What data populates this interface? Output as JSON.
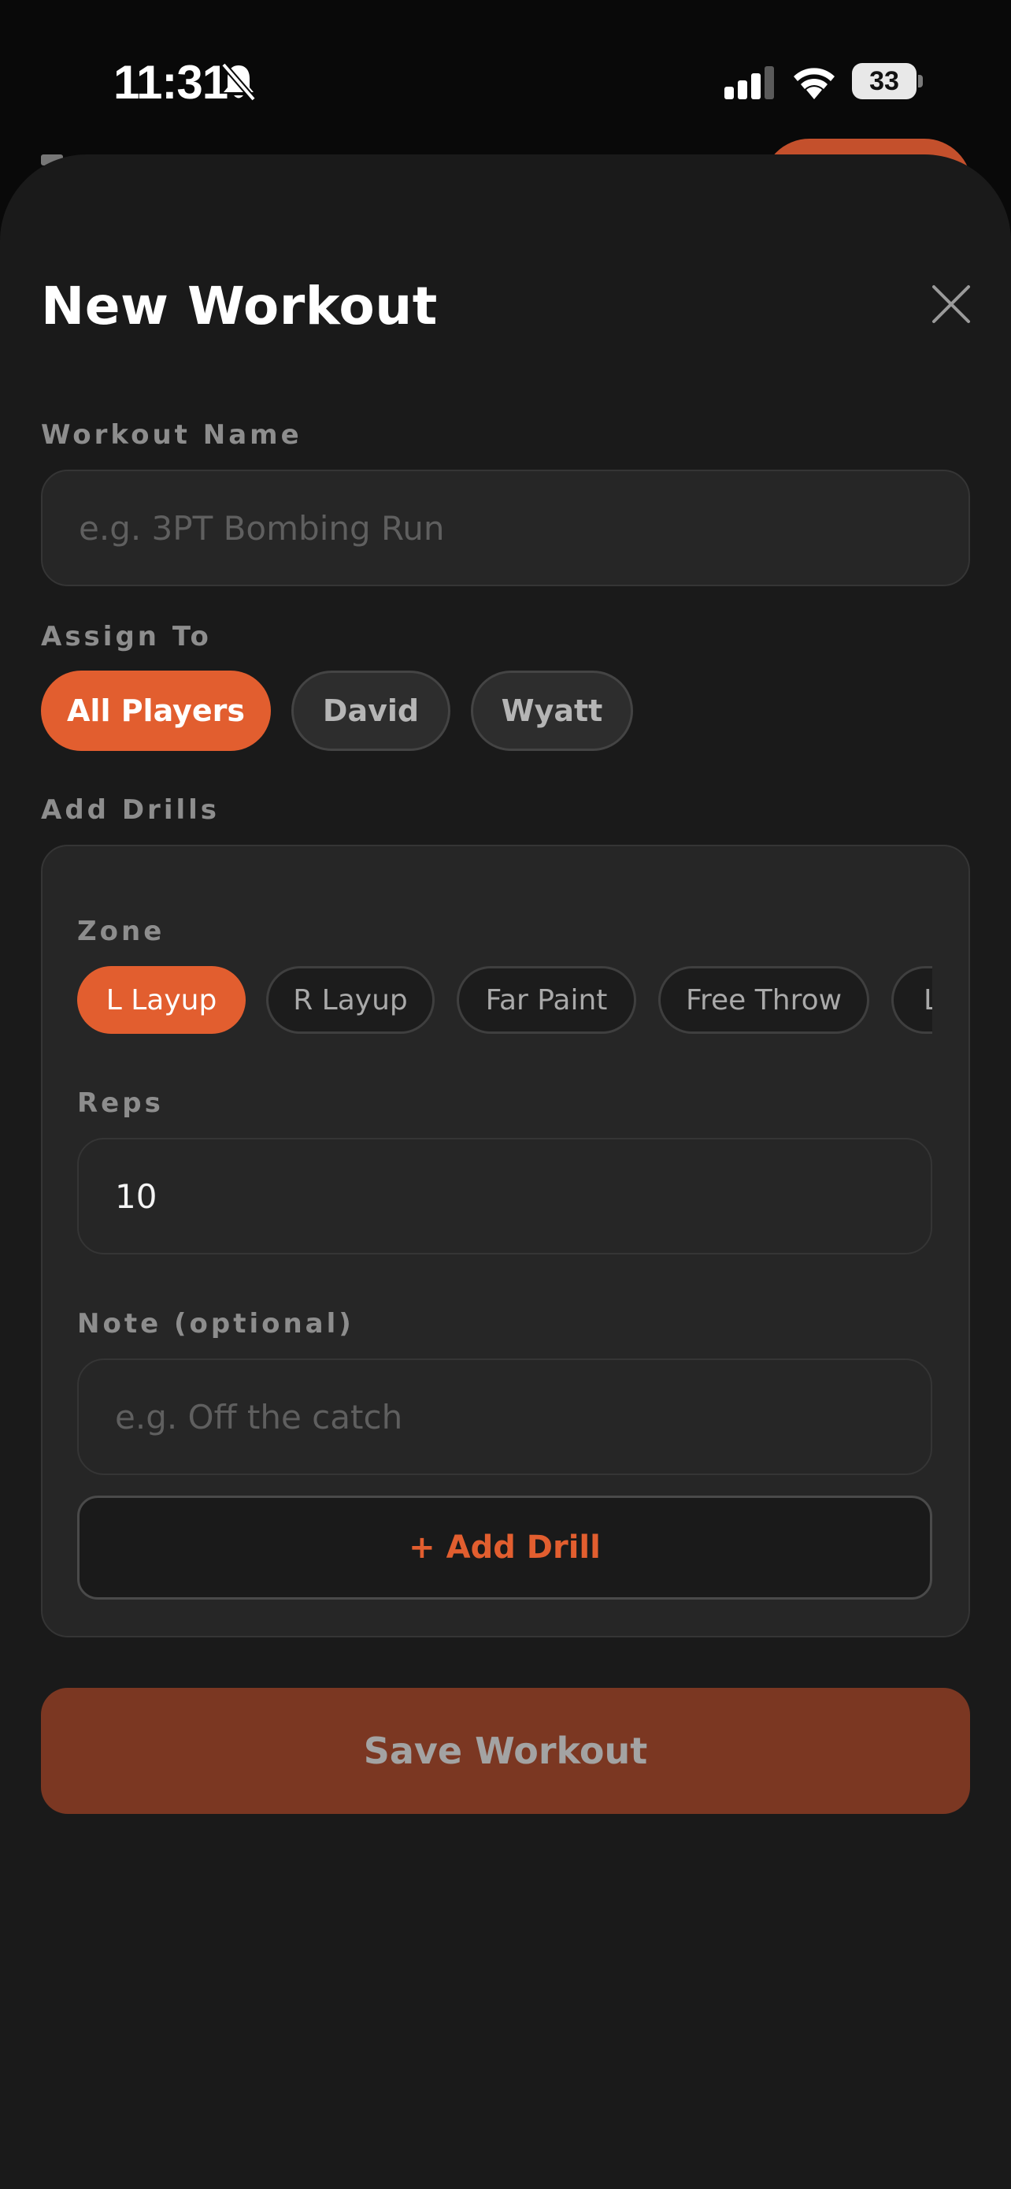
{
  "status_bar": {
    "time": "11:31",
    "battery": "33"
  },
  "sheet": {
    "title": "New Workout"
  },
  "workout_name": {
    "label": "Workout Name",
    "placeholder": "e.g. 3PT Bombing Run",
    "value": ""
  },
  "assign": {
    "label": "Assign To",
    "options": [
      "All Players",
      "David",
      "Wyatt"
    ],
    "selected": "All Players"
  },
  "drills": {
    "label": "Add Drills",
    "zone": {
      "label": "Zone",
      "options": [
        "L Layup",
        "R Layup",
        "Far Paint",
        "Free Throw",
        "L"
      ],
      "selected": "L Layup"
    },
    "reps": {
      "label": "Reps",
      "value": "10"
    },
    "note": {
      "label": "Note (optional)",
      "placeholder": "e.g. Off the catch"
    },
    "add_button": "+ Add Drill"
  },
  "save_button": "Save Workout",
  "colors": {
    "accent": "#e25e2f",
    "save_bg": "#7b3722",
    "sheet_bg": "#1a1a1a",
    "field_bg": "#262626"
  }
}
